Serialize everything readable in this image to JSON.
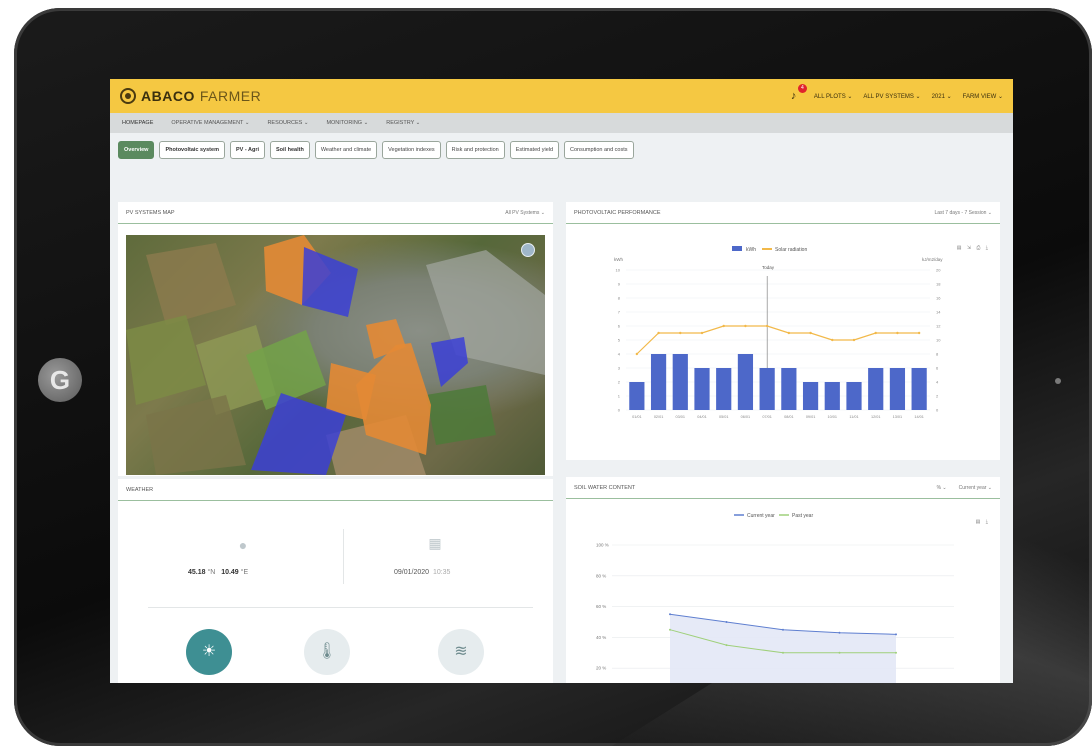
{
  "app": {
    "logo_bold": "ABACO",
    "logo_light": "FARMER",
    "notifications_count": "4",
    "top_menu": [
      "ALL PLOTS ⌄",
      "ALL PV SYSTEMS ⌄",
      "2021 ⌄",
      "FARM VIEW ⌄"
    ]
  },
  "menu": [
    "HOMEPAGE",
    "OPERATIVE MANAGEMENT ⌄",
    "RESOURCES ⌄",
    "MONITORING ⌄",
    "REGISTRY ⌄"
  ],
  "tabs": [
    {
      "label": "Overview",
      "state": "active"
    },
    {
      "label": "Photovoltaic system",
      "state": "bold"
    },
    {
      "label": "PV - Agri",
      "state": "bold"
    },
    {
      "label": "Soil health",
      "state": "bold"
    },
    {
      "label": "Weather and climate",
      "state": "normal"
    },
    {
      "label": "Vegetation indexes",
      "state": "normal"
    },
    {
      "label": "Risk and protection",
      "state": "normal"
    },
    {
      "label": "Estimated yield",
      "state": "normal"
    },
    {
      "label": "Consumption and costs",
      "state": "normal"
    }
  ],
  "map_panel": {
    "title": "PV SYSTEMS MAP",
    "filter": "All PV Systems ⌄"
  },
  "pv_panel": {
    "title": "PHOTOVOLTAIC PERFORMANCE",
    "filter": "Last 7 days - 7 Session ⌄",
    "legend": [
      "kWh",
      "Solar radiation"
    ],
    "left_unit": "kWh",
    "right_unit": "kJ/m2/day",
    "marker": "Today"
  },
  "chart_data": {
    "type": "bar",
    "categories": [
      "01/01",
      "02/01",
      "03/01",
      "04/01",
      "05/01",
      "06/01",
      "07/01",
      "08/01",
      "09/01",
      "10/01",
      "11/01",
      "12/01",
      "13/01",
      "14/01"
    ],
    "series": [
      {
        "name": "kWh",
        "type": "bar",
        "values": [
          2,
          4,
          4,
          3,
          3,
          4,
          3,
          3,
          2,
          2,
          2,
          3,
          3,
          3
        ]
      },
      {
        "name": "Solar radiation",
        "type": "line",
        "values": [
          8,
          11,
          11,
          11,
          12,
          12,
          12,
          11,
          11,
          10,
          10,
          11,
          11,
          11
        ]
      }
    ],
    "ylim": [
      0,
      10
    ],
    "y2lim": [
      0,
      20
    ],
    "y_ticks": [
      "0",
      "1",
      "2",
      "3",
      "4",
      "5",
      "6",
      "7",
      "8",
      "9",
      "10"
    ],
    "y2_ticks": [
      "0",
      "2",
      "4",
      "6",
      "8",
      "10",
      "12",
      "14",
      "16",
      "18",
      "20"
    ],
    "colors": {
      "bar": "#4d68c9",
      "line": "#f2b94a"
    }
  },
  "weather_panel": {
    "title": "WEATHER",
    "lat": "45.18",
    "lat_unit": "°N",
    "lon": "10.49",
    "lon_unit": "°E",
    "date": "09/01/2020",
    "time": "10:35"
  },
  "soil_panel": {
    "title": "SOIL WATER CONTENT",
    "unit_filter": "% ⌄",
    "year_filter": "Current year ⌄",
    "legend": [
      "Current year",
      "Past year"
    ],
    "y_ticks": [
      "100 %",
      "80 %",
      "60 %",
      "40 %",
      "20 %"
    ],
    "current_year": [
      55,
      50,
      45,
      43,
      42
    ],
    "past_year": [
      45,
      35,
      30,
      30,
      30
    ],
    "colors": {
      "current": "#5f7fd0",
      "past": "#9fd07a"
    }
  }
}
